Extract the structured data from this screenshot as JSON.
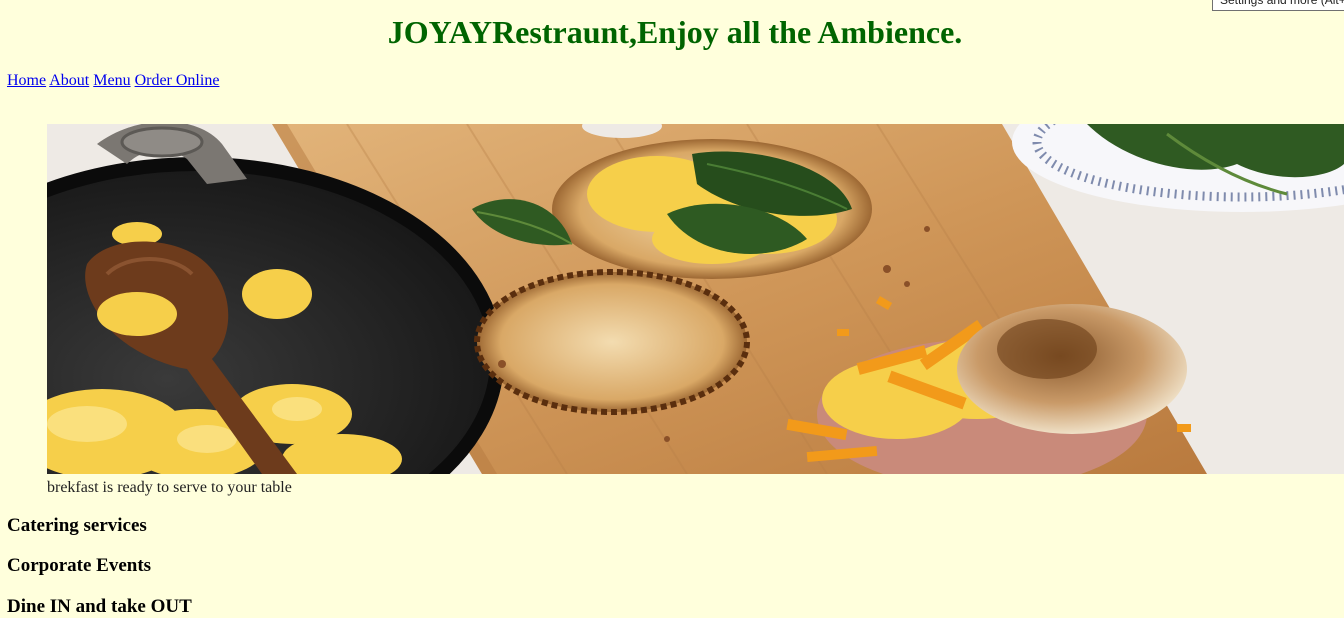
{
  "browser": {
    "tooltip_text": "Settings and more (Alt+F)"
  },
  "header": {
    "title": "JOYAYRestraunt,Enjoy all the Ambience.",
    "title_color": "#006400"
  },
  "nav": {
    "items": [
      {
        "label": "Home"
      },
      {
        "label": "About"
      },
      {
        "label": "Menu"
      },
      {
        "label": "Order Online"
      }
    ]
  },
  "hero": {
    "caption": "brekfast is ready to serve to your table"
  },
  "services": [
    {
      "label": "Catering services"
    },
    {
      "label": "Corporate Events"
    },
    {
      "label": "Dine IN and take OUT"
    }
  ],
  "colors": {
    "background": "#ffffdc",
    "link": "#0000ee"
  }
}
